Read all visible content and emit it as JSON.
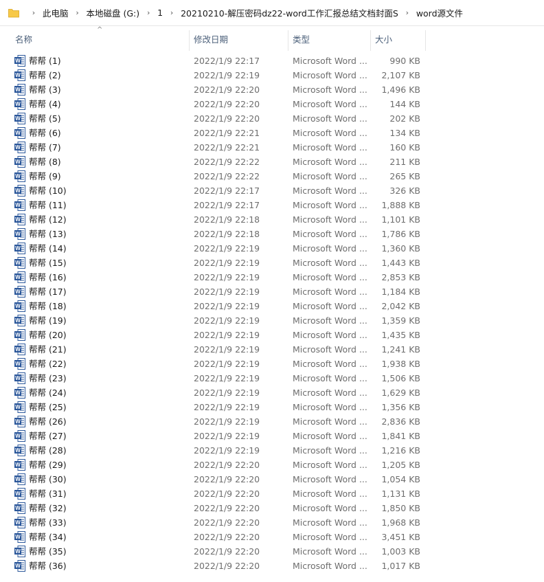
{
  "breadcrumb": [
    "此电脑",
    "本地磁盘 (G:)",
    "1",
    "20210210-解压密码dz22-word工作汇报总结文档封面S",
    "word源文件"
  ],
  "columns": {
    "name": "名称",
    "date": "修改日期",
    "type": "类型",
    "size": "大小"
  },
  "colors": {
    "word_icon": "#2b579a",
    "folder": "#f7c948",
    "header_text": "#4c607a"
  },
  "files": [
    {
      "name": "帮帮 (1)",
      "date": "2022/1/9 22:17",
      "type": "Microsoft Word ...",
      "size": "990 KB"
    },
    {
      "name": "帮帮 (2)",
      "date": "2022/1/9 22:19",
      "type": "Microsoft Word ...",
      "size": "2,107 KB"
    },
    {
      "name": "帮帮 (3)",
      "date": "2022/1/9 22:20",
      "type": "Microsoft Word ...",
      "size": "1,496 KB"
    },
    {
      "name": "帮帮 (4)",
      "date": "2022/1/9 22:20",
      "type": "Microsoft Word ...",
      "size": "144 KB"
    },
    {
      "name": "帮帮 (5)",
      "date": "2022/1/9 22:20",
      "type": "Microsoft Word ...",
      "size": "202 KB"
    },
    {
      "name": "帮帮 (6)",
      "date": "2022/1/9 22:21",
      "type": "Microsoft Word ...",
      "size": "134 KB"
    },
    {
      "name": "帮帮 (7)",
      "date": "2022/1/9 22:21",
      "type": "Microsoft Word ...",
      "size": "160 KB"
    },
    {
      "name": "帮帮 (8)",
      "date": "2022/1/9 22:22",
      "type": "Microsoft Word ...",
      "size": "211 KB"
    },
    {
      "name": "帮帮 (9)",
      "date": "2022/1/9 22:22",
      "type": "Microsoft Word ...",
      "size": "265 KB"
    },
    {
      "name": "帮帮 (10)",
      "date": "2022/1/9 22:17",
      "type": "Microsoft Word ...",
      "size": "326 KB"
    },
    {
      "name": "帮帮 (11)",
      "date": "2022/1/9 22:17",
      "type": "Microsoft Word ...",
      "size": "1,888 KB"
    },
    {
      "name": "帮帮 (12)",
      "date": "2022/1/9 22:18",
      "type": "Microsoft Word ...",
      "size": "1,101 KB"
    },
    {
      "name": "帮帮 (13)",
      "date": "2022/1/9 22:18",
      "type": "Microsoft Word ...",
      "size": "1,786 KB"
    },
    {
      "name": "帮帮 (14)",
      "date": "2022/1/9 22:19",
      "type": "Microsoft Word ...",
      "size": "1,360 KB"
    },
    {
      "name": "帮帮 (15)",
      "date": "2022/1/9 22:19",
      "type": "Microsoft Word ...",
      "size": "1,443 KB"
    },
    {
      "name": "帮帮 (16)",
      "date": "2022/1/9 22:19",
      "type": "Microsoft Word ...",
      "size": "2,853 KB"
    },
    {
      "name": "帮帮 (17)",
      "date": "2022/1/9 22:19",
      "type": "Microsoft Word ...",
      "size": "1,184 KB"
    },
    {
      "name": "帮帮 (18)",
      "date": "2022/1/9 22:19",
      "type": "Microsoft Word ...",
      "size": "2,042 KB"
    },
    {
      "name": "帮帮 (19)",
      "date": "2022/1/9 22:19",
      "type": "Microsoft Word ...",
      "size": "1,359 KB"
    },
    {
      "name": "帮帮 (20)",
      "date": "2022/1/9 22:19",
      "type": "Microsoft Word ...",
      "size": "1,435 KB"
    },
    {
      "name": "帮帮 (21)",
      "date": "2022/1/9 22:19",
      "type": "Microsoft Word ...",
      "size": "1,241 KB"
    },
    {
      "name": "帮帮 (22)",
      "date": "2022/1/9 22:19",
      "type": "Microsoft Word ...",
      "size": "1,938 KB"
    },
    {
      "name": "帮帮 (23)",
      "date": "2022/1/9 22:19",
      "type": "Microsoft Word ...",
      "size": "1,506 KB"
    },
    {
      "name": "帮帮 (24)",
      "date": "2022/1/9 22:19",
      "type": "Microsoft Word ...",
      "size": "1,629 KB"
    },
    {
      "name": "帮帮 (25)",
      "date": "2022/1/9 22:19",
      "type": "Microsoft Word ...",
      "size": "1,356 KB"
    },
    {
      "name": "帮帮 (26)",
      "date": "2022/1/9 22:19",
      "type": "Microsoft Word ...",
      "size": "2,836 KB"
    },
    {
      "name": "帮帮 (27)",
      "date": "2022/1/9 22:19",
      "type": "Microsoft Word ...",
      "size": "1,841 KB"
    },
    {
      "name": "帮帮 (28)",
      "date": "2022/1/9 22:19",
      "type": "Microsoft Word ...",
      "size": "1,216 KB"
    },
    {
      "name": "帮帮 (29)",
      "date": "2022/1/9 22:20",
      "type": "Microsoft Word ...",
      "size": "1,205 KB"
    },
    {
      "name": "帮帮 (30)",
      "date": "2022/1/9 22:20",
      "type": "Microsoft Word ...",
      "size": "1,054 KB"
    },
    {
      "name": "帮帮 (31)",
      "date": "2022/1/9 22:20",
      "type": "Microsoft Word ...",
      "size": "1,131 KB"
    },
    {
      "name": "帮帮 (32)",
      "date": "2022/1/9 22:20",
      "type": "Microsoft Word ...",
      "size": "1,850 KB"
    },
    {
      "name": "帮帮 (33)",
      "date": "2022/1/9 22:20",
      "type": "Microsoft Word ...",
      "size": "1,968 KB"
    },
    {
      "name": "帮帮 (34)",
      "date": "2022/1/9 22:20",
      "type": "Microsoft Word ...",
      "size": "3,451 KB"
    },
    {
      "name": "帮帮 (35)",
      "date": "2022/1/9 22:20",
      "type": "Microsoft Word ...",
      "size": "1,003 KB"
    },
    {
      "name": "帮帮 (36)",
      "date": "2022/1/9 22:20",
      "type": "Microsoft Word ...",
      "size": "1,017 KB"
    }
  ]
}
